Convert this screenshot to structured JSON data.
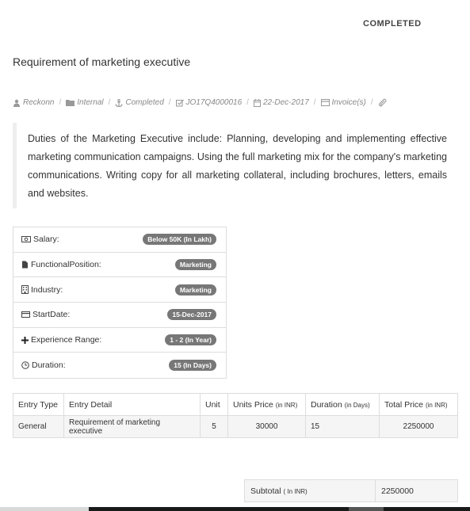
{
  "status": "COMPLETED",
  "title": "Requirement of marketing executive",
  "meta": {
    "company": "Reckonn",
    "type": "Internal",
    "state": "Completed",
    "job_id": "JO17Q4000016",
    "date": "22-Dec-2017",
    "invoices": "Invoice(s)"
  },
  "description": "Duties of the Marketing Executive include: Planning, developing and implementing effective marketing communication campaigns. Using the full marketing mix for the company's marketing communications. Writing copy for all marketing collateral, including brochures, letters, emails and websites.",
  "details": [
    {
      "label": "Salary:",
      "value": "Below 50K   (In Lakh)",
      "icon": "money-icon"
    },
    {
      "label": "FunctionalPosition:",
      "value": "Marketing",
      "icon": "file-icon"
    },
    {
      "label": "Industry:",
      "value": "Marketing",
      "icon": "building-icon"
    },
    {
      "label": "StartDate:",
      "value": "15-Dec-2017",
      "icon": "card-icon"
    },
    {
      "label": "Experience Range:",
      "value": "1 - 2   (In Year)",
      "icon": "plus-icon"
    },
    {
      "label": "Duration:",
      "value": "15  (In Days)",
      "icon": "clock-icon"
    }
  ],
  "table": {
    "headers": {
      "entry_type": "Entry Type",
      "entry_detail": "Entry Detail",
      "unit": "Unit",
      "units_price": "Units Price",
      "units_price_unit": "(in INR)",
      "duration": "Duration",
      "duration_unit": "(in Days)",
      "total_price": "Total Price",
      "total_price_unit": "(in INR)"
    },
    "rows": [
      {
        "entry_type": "General",
        "entry_detail": "Requirement of marketing executive",
        "unit": "5",
        "units_price": "30000",
        "duration": "15",
        "total_price": "2250000"
      }
    ]
  },
  "subtotal": {
    "label": "Subtotal",
    "unit": "( In INR)",
    "value": "2250000"
  }
}
